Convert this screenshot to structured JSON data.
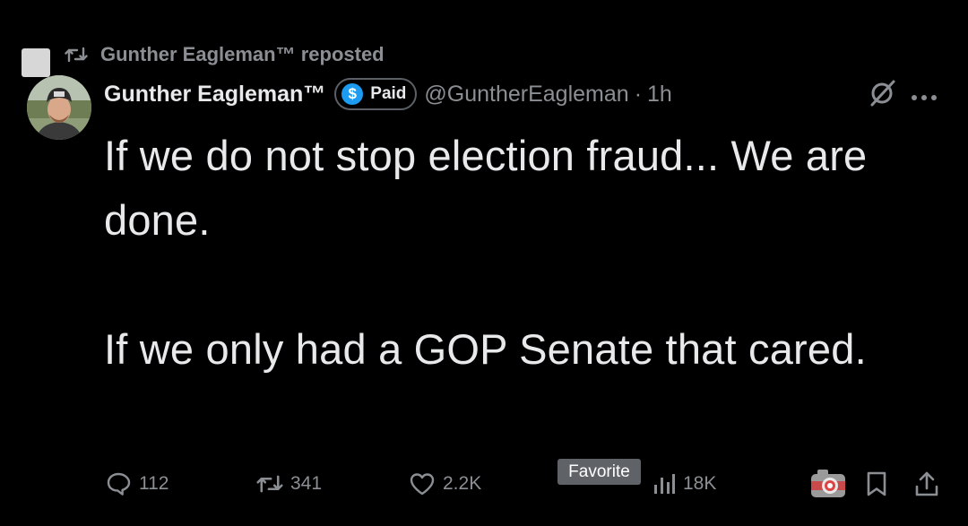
{
  "repost": {
    "text": "Gunther Eagleman™ reposted"
  },
  "tweet": {
    "author_name": "Gunther Eagleman™",
    "badge_label": "Paid",
    "badge_symbol": "$",
    "handle": "@GuntherEagleman",
    "separator": "·",
    "time": "1h",
    "paragraph_1": "If we do not stop election fraud... We are done.",
    "paragraph_2": "If we only had a GOP Senate that cared."
  },
  "actions": {
    "replies": "112",
    "reposts": "341",
    "likes": "2.2K",
    "views": "18K"
  },
  "tooltip": {
    "label": "Favorite"
  },
  "colors": {
    "background": "#000000",
    "text": "#e7e9ea",
    "muted": "#8b8f94",
    "badge_blue": "#1d9bf0",
    "tooltip_bg": "#5f6368"
  },
  "icons": [
    "repost-icon",
    "reply-icon",
    "like-icon",
    "views-icon",
    "grok-icon",
    "more-icon",
    "camera-icon",
    "bookmark-icon",
    "share-icon"
  ]
}
